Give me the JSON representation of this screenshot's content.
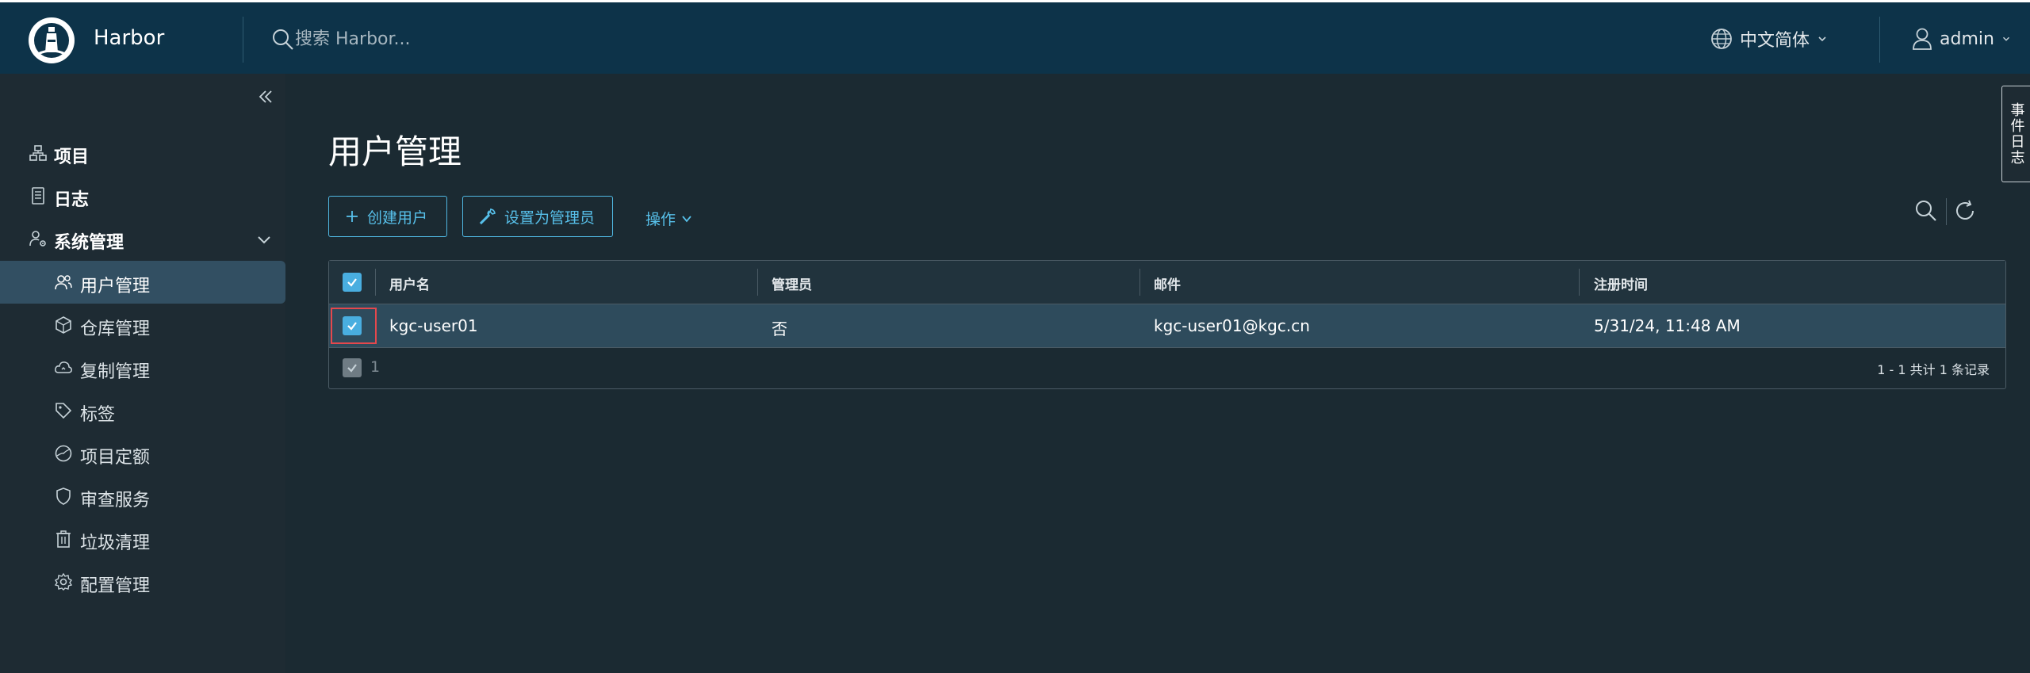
{
  "header": {
    "brand": "Harbor",
    "search_placeholder": "搜索 Harbor...",
    "language": "中文简体",
    "user": "admin"
  },
  "sidebar": {
    "items": [
      {
        "label": "项目",
        "icon": "projects-icon"
      },
      {
        "label": "日志",
        "icon": "logs-icon"
      },
      {
        "label": "系统管理",
        "icon": "system-admin-icon"
      }
    ],
    "sub_items": [
      {
        "label": "用户管理",
        "icon": "users-icon",
        "active": true
      },
      {
        "label": "仓库管理",
        "icon": "registries-icon"
      },
      {
        "label": "复制管理",
        "icon": "replication-icon"
      },
      {
        "label": "标签",
        "icon": "tag-icon"
      },
      {
        "label": "项目定额",
        "icon": "quota-icon"
      },
      {
        "label": "审查服务",
        "icon": "shield-icon"
      },
      {
        "label": "垃圾清理",
        "icon": "trash-icon"
      },
      {
        "label": "配置管理",
        "icon": "gear-icon"
      }
    ]
  },
  "main": {
    "title": "用户管理",
    "buttons": {
      "create_user": "创建用户",
      "set_admin": "设置为管理员",
      "actions": "操作"
    },
    "table": {
      "columns": [
        "用户名",
        "管理员",
        "邮件",
        "注册时间"
      ],
      "rows": [
        {
          "username": "kgc-user01",
          "admin": "否",
          "email": "kgc-user01@kgc.cn",
          "registered": "5/31/24, 11:48 AM",
          "selected": true
        }
      ],
      "selected_count": "1",
      "pagination": "1 - 1 共计 1 条记录"
    }
  },
  "event_tab": "事件日志",
  "colors": {
    "header_bg": "#0d3349",
    "sidebar_bg": "#1e2b33",
    "main_bg": "#1b2a32",
    "accent": "#57c0ea",
    "active_nav": "#324f62",
    "selected_row": "#2e4b5c",
    "highlight_border": "#e5484d"
  }
}
